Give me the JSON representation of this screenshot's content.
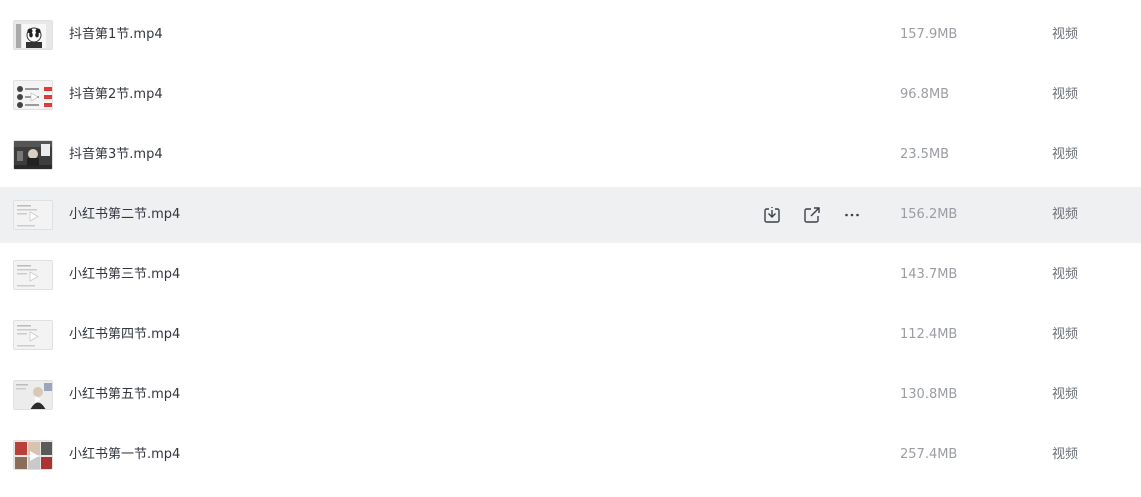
{
  "files": [
    {
      "name": "抖音第1节.mp4",
      "size": "157.9MB",
      "type": "视频",
      "thumb": "panda"
    },
    {
      "name": "抖音第2节.mp4",
      "size": "96.8MB",
      "type": "视频",
      "thumb": "list-red"
    },
    {
      "name": "抖音第3节.mp4",
      "size": "23.5MB",
      "type": "视频",
      "thumb": "dark-scene"
    },
    {
      "name": "小红书第二节.mp4",
      "size": "156.2MB",
      "type": "视频",
      "thumb": "doc-play",
      "hovered": true
    },
    {
      "name": "小红书第三节.mp4",
      "size": "143.7MB",
      "type": "视频",
      "thumb": "doc-play"
    },
    {
      "name": "小红书第四节.mp4",
      "size": "112.4MB",
      "type": "视频",
      "thumb": "doc-play"
    },
    {
      "name": "小红书第五节.mp4",
      "size": "130.8MB",
      "type": "视频",
      "thumb": "person"
    },
    {
      "name": "小红书第一节.mp4",
      "size": "257.4MB",
      "type": "视频",
      "thumb": "collage"
    }
  ],
  "row_actions": {
    "icons": [
      "download-icon",
      "share-icon",
      "more-icon"
    ]
  },
  "colors": {
    "hover_bg": "#eff0f1",
    "name_text": "#333740",
    "size_text": "#9a9da3",
    "type_text": "#6b6f76",
    "icon": "#3c4048"
  }
}
